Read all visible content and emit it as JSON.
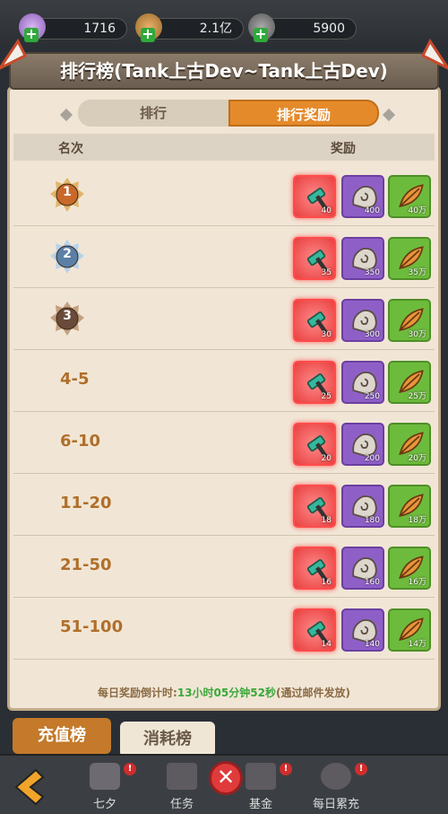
{
  "resources": [
    {
      "name": "resource-1",
      "value": "1716",
      "icon": "flower-icon",
      "color": "#b48cd8"
    },
    {
      "name": "resource-2",
      "value": "2.1亿",
      "icon": "leaf-icon",
      "color": "#c88a3b"
    },
    {
      "name": "resource-3",
      "value": "5900",
      "icon": "stone-icon",
      "color": "#888888"
    }
  ],
  "title": "排行榜(Tank上古Dev~Tank上古Dev)",
  "tabs": {
    "rank": "排行",
    "rank_reward": "排行奖励"
  },
  "table": {
    "col_rank": "名次",
    "col_reward": "奖励"
  },
  "rows": [
    {
      "rank": "1",
      "type": "medal-gold",
      "r1": "40",
      "r2": "400",
      "r3": "40万"
    },
    {
      "rank": "2",
      "type": "medal-silver",
      "r1": "35",
      "r2": "350",
      "r3": "35万"
    },
    {
      "rank": "3",
      "type": "medal-bronze",
      "r1": "30",
      "r2": "300",
      "r3": "30万"
    },
    {
      "rank": "4-5",
      "type": "text",
      "r1": "25",
      "r2": "250",
      "r3": "25万"
    },
    {
      "rank": "6-10",
      "type": "text",
      "r1": "20",
      "r2": "200",
      "r3": "20万"
    },
    {
      "rank": "11-20",
      "type": "text",
      "r1": "18",
      "r2": "180",
      "r3": "18万"
    },
    {
      "rank": "21-50",
      "type": "text",
      "r1": "16",
      "r2": "160",
      "r3": "16万"
    },
    {
      "rank": "51-100",
      "type": "text",
      "r1": "14",
      "r2": "140",
      "r3": "14万"
    }
  ],
  "footer": {
    "prefix": "每日奖励倒计时:",
    "time": "13小时05分钟52秒",
    "suffix": "(通过邮件发放)"
  },
  "side_tabs": {
    "charge": "充值榜",
    "consume": "消耗榜"
  },
  "nav": {
    "item1": "七夕",
    "item2": "任务",
    "item3": "基金",
    "item4": "每日累充",
    "badge": "!"
  },
  "colors": {
    "active_tab": "#e58a2a",
    "panel_bg": "#f1e6d6",
    "rank_text": "#b06f2a",
    "timer_green": "#3aa83a"
  }
}
